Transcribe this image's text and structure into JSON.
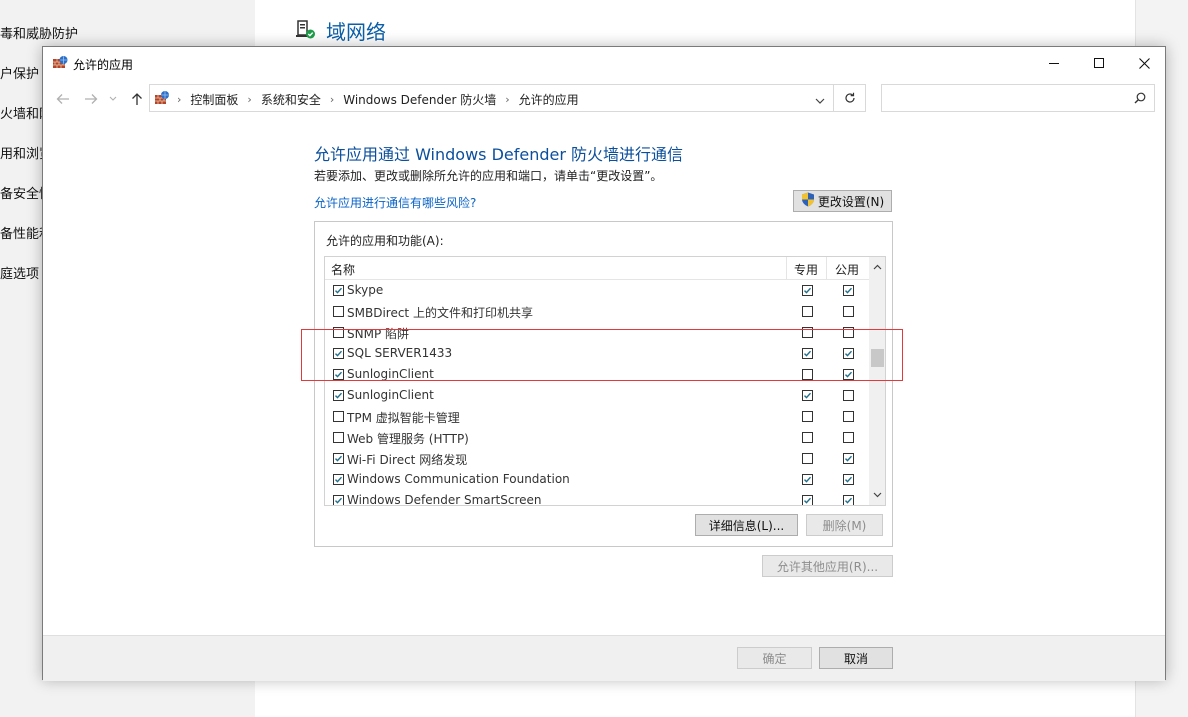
{
  "background": {
    "sidebar_items": [
      "毒和威胁防护",
      "户保护",
      "火墙和网",
      "用和浏览",
      "备安全性",
      "备性能和",
      "庭选项"
    ],
    "network_heading": "域网络"
  },
  "window": {
    "title": "允许的应用",
    "minimize_label": "─",
    "maximize_label": "☐",
    "close_label": "✕"
  },
  "address": {
    "breadcrumbs": [
      "控制面板",
      "系统和安全",
      "Windows Defender 防火墙",
      "允许的应用"
    ],
    "search_placeholder": ""
  },
  "content": {
    "title": "允许应用通过 Windows Defender 防火墙进行通信",
    "description": "若要添加、更改或删除所允许的应用和端口，请单击“更改设置”。",
    "risk_link": "允许应用进行通信有哪些风险?",
    "change_settings_label": "更改设置(N)",
    "group_label": "允许的应用和功能(A):",
    "columns": {
      "name": "名称",
      "private": "专用",
      "public": "公用"
    },
    "apps": [
      {
        "name": "Skype",
        "enabled": true,
        "private": true,
        "public": true
      },
      {
        "name": "SMBDirect 上的文件和打印机共享",
        "enabled": false,
        "private": false,
        "public": false
      },
      {
        "name": "SNMP 陷阱",
        "enabled": false,
        "private": false,
        "public": false
      },
      {
        "name": "SQL SERVER1433",
        "enabled": true,
        "private": true,
        "public": true
      },
      {
        "name": "SunloginClient",
        "enabled": true,
        "private": false,
        "public": true
      },
      {
        "name": "SunloginClient",
        "enabled": true,
        "private": true,
        "public": false
      },
      {
        "name": "TPM 虚拟智能卡管理",
        "enabled": false,
        "private": false,
        "public": false
      },
      {
        "name": "Web 管理服务 (HTTP)",
        "enabled": false,
        "private": false,
        "public": false
      },
      {
        "name": "Wi-Fi Direct 网络发现",
        "enabled": true,
        "private": false,
        "public": true
      },
      {
        "name": "Windows Communication Foundation",
        "enabled": true,
        "private": true,
        "public": true
      },
      {
        "name": "Windows Defender SmartScreen",
        "enabled": true,
        "private": true,
        "public": true
      }
    ],
    "details_label": "详细信息(L)...",
    "remove_label": "删除(M)",
    "allow_other_label": "允许其他应用(R)..."
  },
  "footer": {
    "ok_label": "确定",
    "cancel_label": "取消"
  },
  "colors": {
    "accent": "#0b4f9c",
    "link": "#0a63c7",
    "highlight": "#e03a3a",
    "check": "#1f6f8b"
  }
}
